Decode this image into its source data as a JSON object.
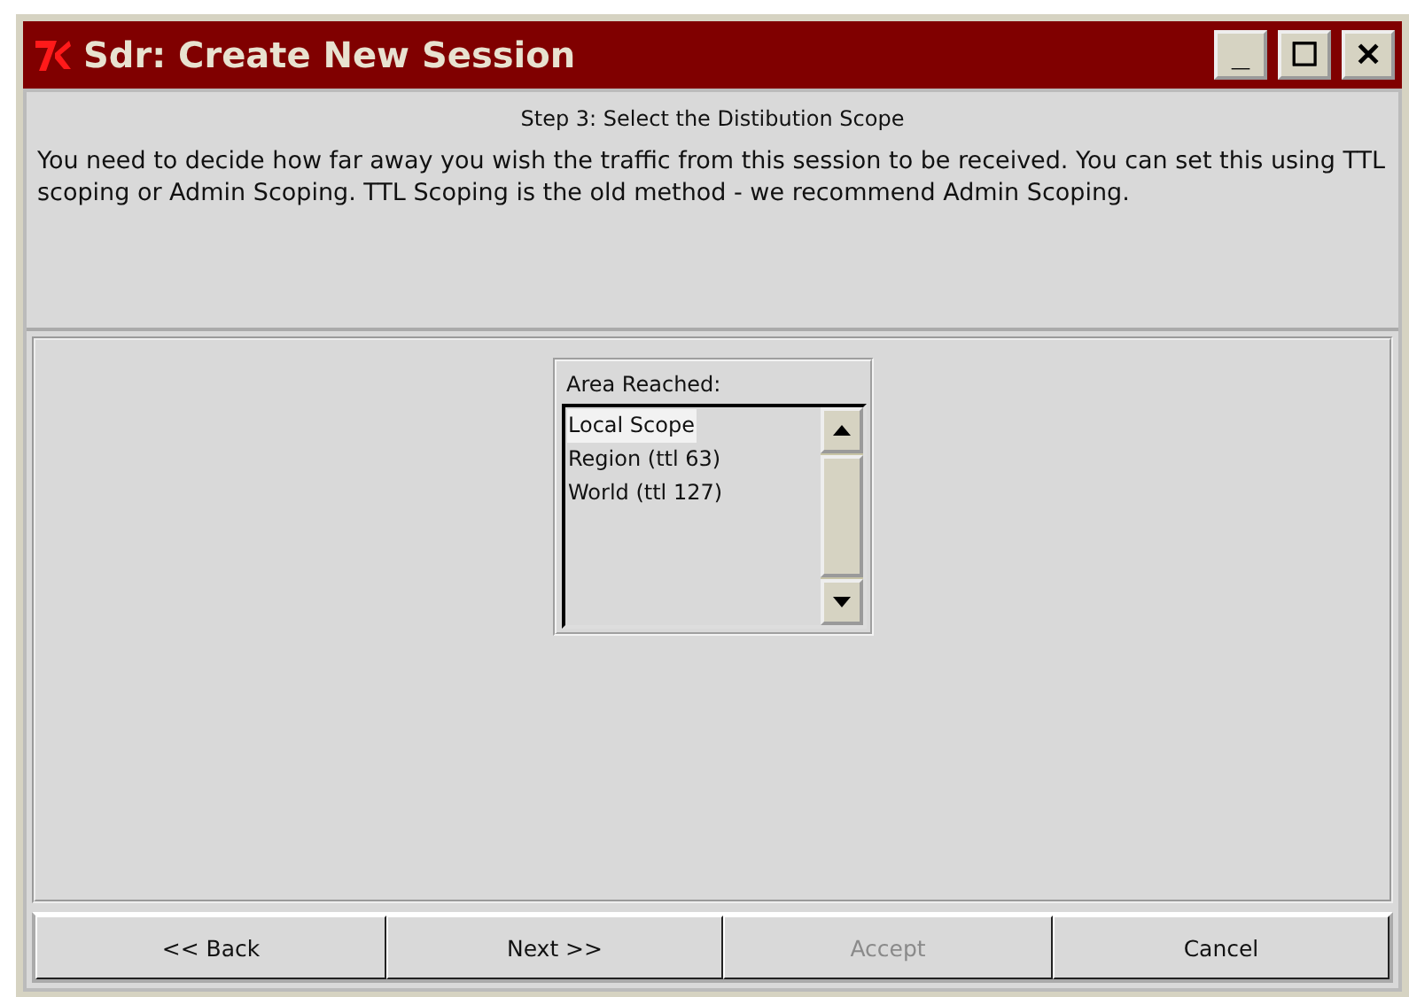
{
  "window": {
    "title": "Sdr: Create New Session",
    "controls": [
      "_",
      "☐",
      "✕"
    ]
  },
  "step_title": "Step 3: Select the Distibution Scope",
  "description": "You need to decide how far away you wish the traffic from this session to be received.  You can set this using TTL scoping or Admin Scoping.  TTL Scoping is the old method - we recommend Admin Scoping.",
  "scope_list": {
    "label": "Area Reached:",
    "items": [
      {
        "text": "Local Scope",
        "selected": true
      },
      {
        "text": "Region (ttl 63)",
        "selected": false
      },
      {
        "text": "World (ttl 127)",
        "selected": false
      }
    ]
  },
  "buttons": [
    {
      "label": "<< Back",
      "disabled": false
    },
    {
      "label": "Next >>",
      "disabled": false
    },
    {
      "label": "Accept",
      "disabled": true
    },
    {
      "label": "Cancel",
      "disabled": false
    }
  ]
}
